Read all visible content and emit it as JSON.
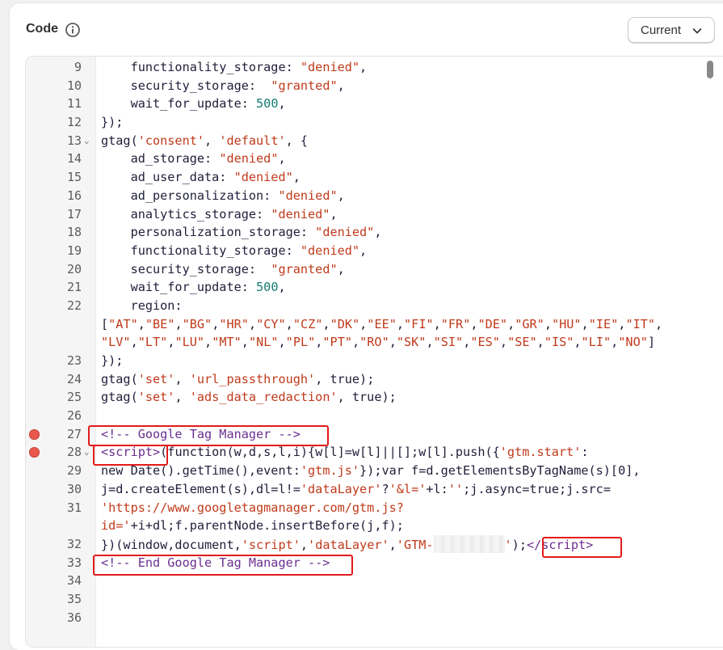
{
  "header": {
    "title": "Code",
    "version_label": "Current"
  },
  "editor": {
    "lines": [
      {
        "no": "9",
        "html": "    functionality_storage: <span class=\"s\">\"denied\"</span>,"
      },
      {
        "no": "10",
        "html": "    security_storage:  <span class=\"s\">\"granted\"</span>,"
      },
      {
        "no": "11",
        "html": "    wait_for_update: <span class=\"n\">500</span>,"
      },
      {
        "no": "12",
        "html": "});"
      },
      {
        "no": "13",
        "fold": true,
        "html": "gtag(<span class=\"s\">'consent'</span>, <span class=\"s\">'default'</span>, {"
      },
      {
        "no": "14",
        "html": "    ad_storage: <span class=\"s\">\"denied\"</span>,"
      },
      {
        "no": "15",
        "html": "    ad_user_data: <span class=\"s\">\"denied\"</span>,"
      },
      {
        "no": "16",
        "html": "    ad_personalization: <span class=\"s\">\"denied\"</span>,"
      },
      {
        "no": "17",
        "html": "    analytics_storage: <span class=\"s\">\"denied\"</span>,"
      },
      {
        "no": "18",
        "html": "    personalization_storage: <span class=\"s\">\"denied\"</span>,"
      },
      {
        "no": "19",
        "html": "    functionality_storage: <span class=\"s\">\"denied\"</span>,"
      },
      {
        "no": "20",
        "html": "    security_storage:  <span class=\"s\">\"granted\"</span>,"
      },
      {
        "no": "21",
        "html": "    wait_for_update: <span class=\"n\">500</span>,"
      },
      {
        "no": "22",
        "html": "    region:"
      },
      {
        "no": "",
        "html": "[<span class=\"s\">\"AT\"</span>,<span class=\"s\">\"BE\"</span>,<span class=\"s\">\"BG\"</span>,<span class=\"s\">\"HR\"</span>,<span class=\"s\">\"CY\"</span>,<span class=\"s\">\"CZ\"</span>,<span class=\"s\">\"DK\"</span>,<span class=\"s\">\"EE\"</span>,<span class=\"s\">\"FI\"</span>,<span class=\"s\">\"FR\"</span>,<span class=\"s\">\"DE\"</span>,<span class=\"s\">\"GR\"</span>,<span class=\"s\">\"HU\"</span>,<span class=\"s\">\"IE\"</span>,<span class=\"s\">\"IT\"</span>,"
      },
      {
        "no": "",
        "html": "<span class=\"s\">\"LV\"</span>,<span class=\"s\">\"LT\"</span>,<span class=\"s\">\"LU\"</span>,<span class=\"s\">\"MT\"</span>,<span class=\"s\">\"NL\"</span>,<span class=\"s\">\"PL\"</span>,<span class=\"s\">\"PT\"</span>,<span class=\"s\">\"RO\"</span>,<span class=\"s\">\"SK\"</span>,<span class=\"s\">\"SI\"</span>,<span class=\"s\">\"ES\"</span>,<span class=\"s\">\"SE\"</span>,<span class=\"s\">\"IS\"</span>,<span class=\"s\">\"LI\"</span>,<span class=\"s\">\"NO\"</span>]"
      },
      {
        "no": "23",
        "html": "});"
      },
      {
        "no": "24",
        "html": "gtag(<span class=\"s\">'set'</span>, <span class=\"s\">'url_passthrough'</span>, true);"
      },
      {
        "no": "25",
        "html": "gtag(<span class=\"s\">'set'</span>, <span class=\"s\">'ads_data_redaction'</span>, true);"
      },
      {
        "no": "26",
        "html": ""
      },
      {
        "no": "27",
        "bp": true,
        "html": "<span class=\"c\">&lt;!-- Google Tag Manager --&gt;</span>"
      },
      {
        "no": "28",
        "bp": true,
        "fold": true,
        "html": "<span class=\"c\">&lt;script&gt;</span>(function(w,d,s,l,i){w[l]=w[l]||[];w[l].push({<span class=\"s\">'gtm.start'</span>:"
      },
      {
        "no": "29",
        "html": "new Date().getTime(),event:<span class=\"s\">'gtm.js'</span>});var f=d.getElementsByTagName(s)[0],"
      },
      {
        "no": "30",
        "html": "j=d.createElement(s),dl=l!=<span class=\"s\">'dataLayer'</span>?<span class=\"s\">'&amp;l='</span>+l:<span class=\"s\">''</span>;j.async=true;j.src="
      },
      {
        "no": "31",
        "html": "<span class=\"s\">'https://www.googletagmanager.com/gtm.js?</span>"
      },
      {
        "no": "",
        "html": "<span class=\"s\">id='</span>+i+dl;f.parentNode.insertBefore(j,f);"
      },
      {
        "no": "32",
        "html": "})(window,document,<span class=\"s\">'script'</span>,<span class=\"s\">'dataLayer'</span>,<span class=\"s\">'GTM-<span class=\"blur\"></span>'</span>);<span class=\"c\">&lt;/script&gt;</span>"
      },
      {
        "no": "33",
        "html": "<span class=\"c\">&lt;!-- End Google Tag Manager --&gt;</span>"
      },
      {
        "no": "34",
        "html": ""
      },
      {
        "no": "35",
        "html": ""
      },
      {
        "no": "36",
        "html": ""
      }
    ]
  }
}
